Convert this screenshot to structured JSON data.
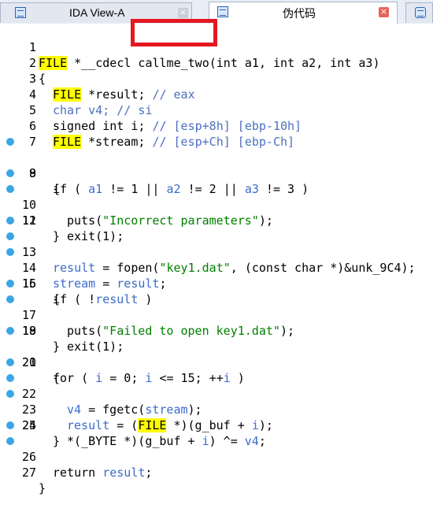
{
  "tabs": [
    {
      "title": "IDA View-A",
      "close": "×"
    },
    {
      "title": "伪代码",
      "close": "×"
    }
  ],
  "code": {
    "line_numbers": [
      "1",
      "2",
      "3",
      "4",
      "5",
      "6",
      "7",
      "8",
      "9",
      "10",
      "11",
      "12",
      "13",
      "14",
      "15",
      "16",
      "17",
      "18",
      "19",
      "20",
      "21",
      "22",
      "23",
      "24",
      "25",
      "26",
      "27"
    ],
    "l1": {
      "type": "FILE",
      "rest": " *__cdecl callme_two(int a1, int a2, int a3)"
    },
    "l2": "{",
    "l3": {
      "type": "FILE",
      "rest": " *result; ",
      "comment": "// eax"
    },
    "l4": {
      "code": "char v4; ",
      "comment": "// si"
    },
    "l5": {
      "code": "signed int i; ",
      "comment": "// [esp+8h] [ebp-10h]"
    },
    "l6": {
      "type": "FILE",
      "rest": " *stream; ",
      "comment": "// [esp+Ch] [ebp-Ch]"
    },
    "l7": "",
    "l8": {
      "a": "if ( ",
      "v1": "a1",
      "b": " != 1 || ",
      "v2": "a2",
      "c": " != 2 || ",
      "v3": "a3",
      "d": " != 3 )"
    },
    "l9": "{",
    "l10": {
      "a": "puts(",
      "s": "\"Incorrect parameters\"",
      "b": ");"
    },
    "l11": "exit(1);",
    "l12": "}",
    "l13": {
      "v": "result",
      "a": " = fopen(",
      "s": "\"key1.dat\"",
      "b": ", (const char *)&unk_9C4);"
    },
    "l14": {
      "v1": "stream",
      "a": " = ",
      "v2": "result",
      "b": ";"
    },
    "l15": {
      "a": "if ( !",
      "v": "result",
      "b": " )"
    },
    "l16": "{",
    "l17": {
      "a": "puts(",
      "s": "\"Failed to open key1.dat\"",
      "b": ");"
    },
    "l18": "exit(1);",
    "l19": "}",
    "l20": {
      "a": "for ( ",
      "v1": "i",
      "b": " = 0; ",
      "v2": "i",
      "c": " <= 15; ++",
      "v3": "i",
      "d": " )"
    },
    "l21": "{",
    "l22": {
      "v1": "v4",
      "a": " = fgetc(",
      "v2": "stream",
      "b": ");"
    },
    "l23": {
      "v1": "result",
      "a": " = (",
      "type": "FILE",
      "b": " *)(g_buf + ",
      "v2": "i",
      "c": ");"
    },
    "l24": {
      "a": "*(_BYTE *)(g_buf + ",
      "v1": "i",
      "b": ") ^= ",
      "v2": "v4",
      "c": ";"
    },
    "l25": "}",
    "l26": {
      "a": "return ",
      "v": "result",
      "b": ";"
    },
    "l27": "}"
  },
  "colors": {
    "variable": "#3c6bcb",
    "string": "#008000",
    "highlight": "#ffff00",
    "annotation_box": "#e5171f",
    "breakpoint_dot": "#39a6e6"
  }
}
